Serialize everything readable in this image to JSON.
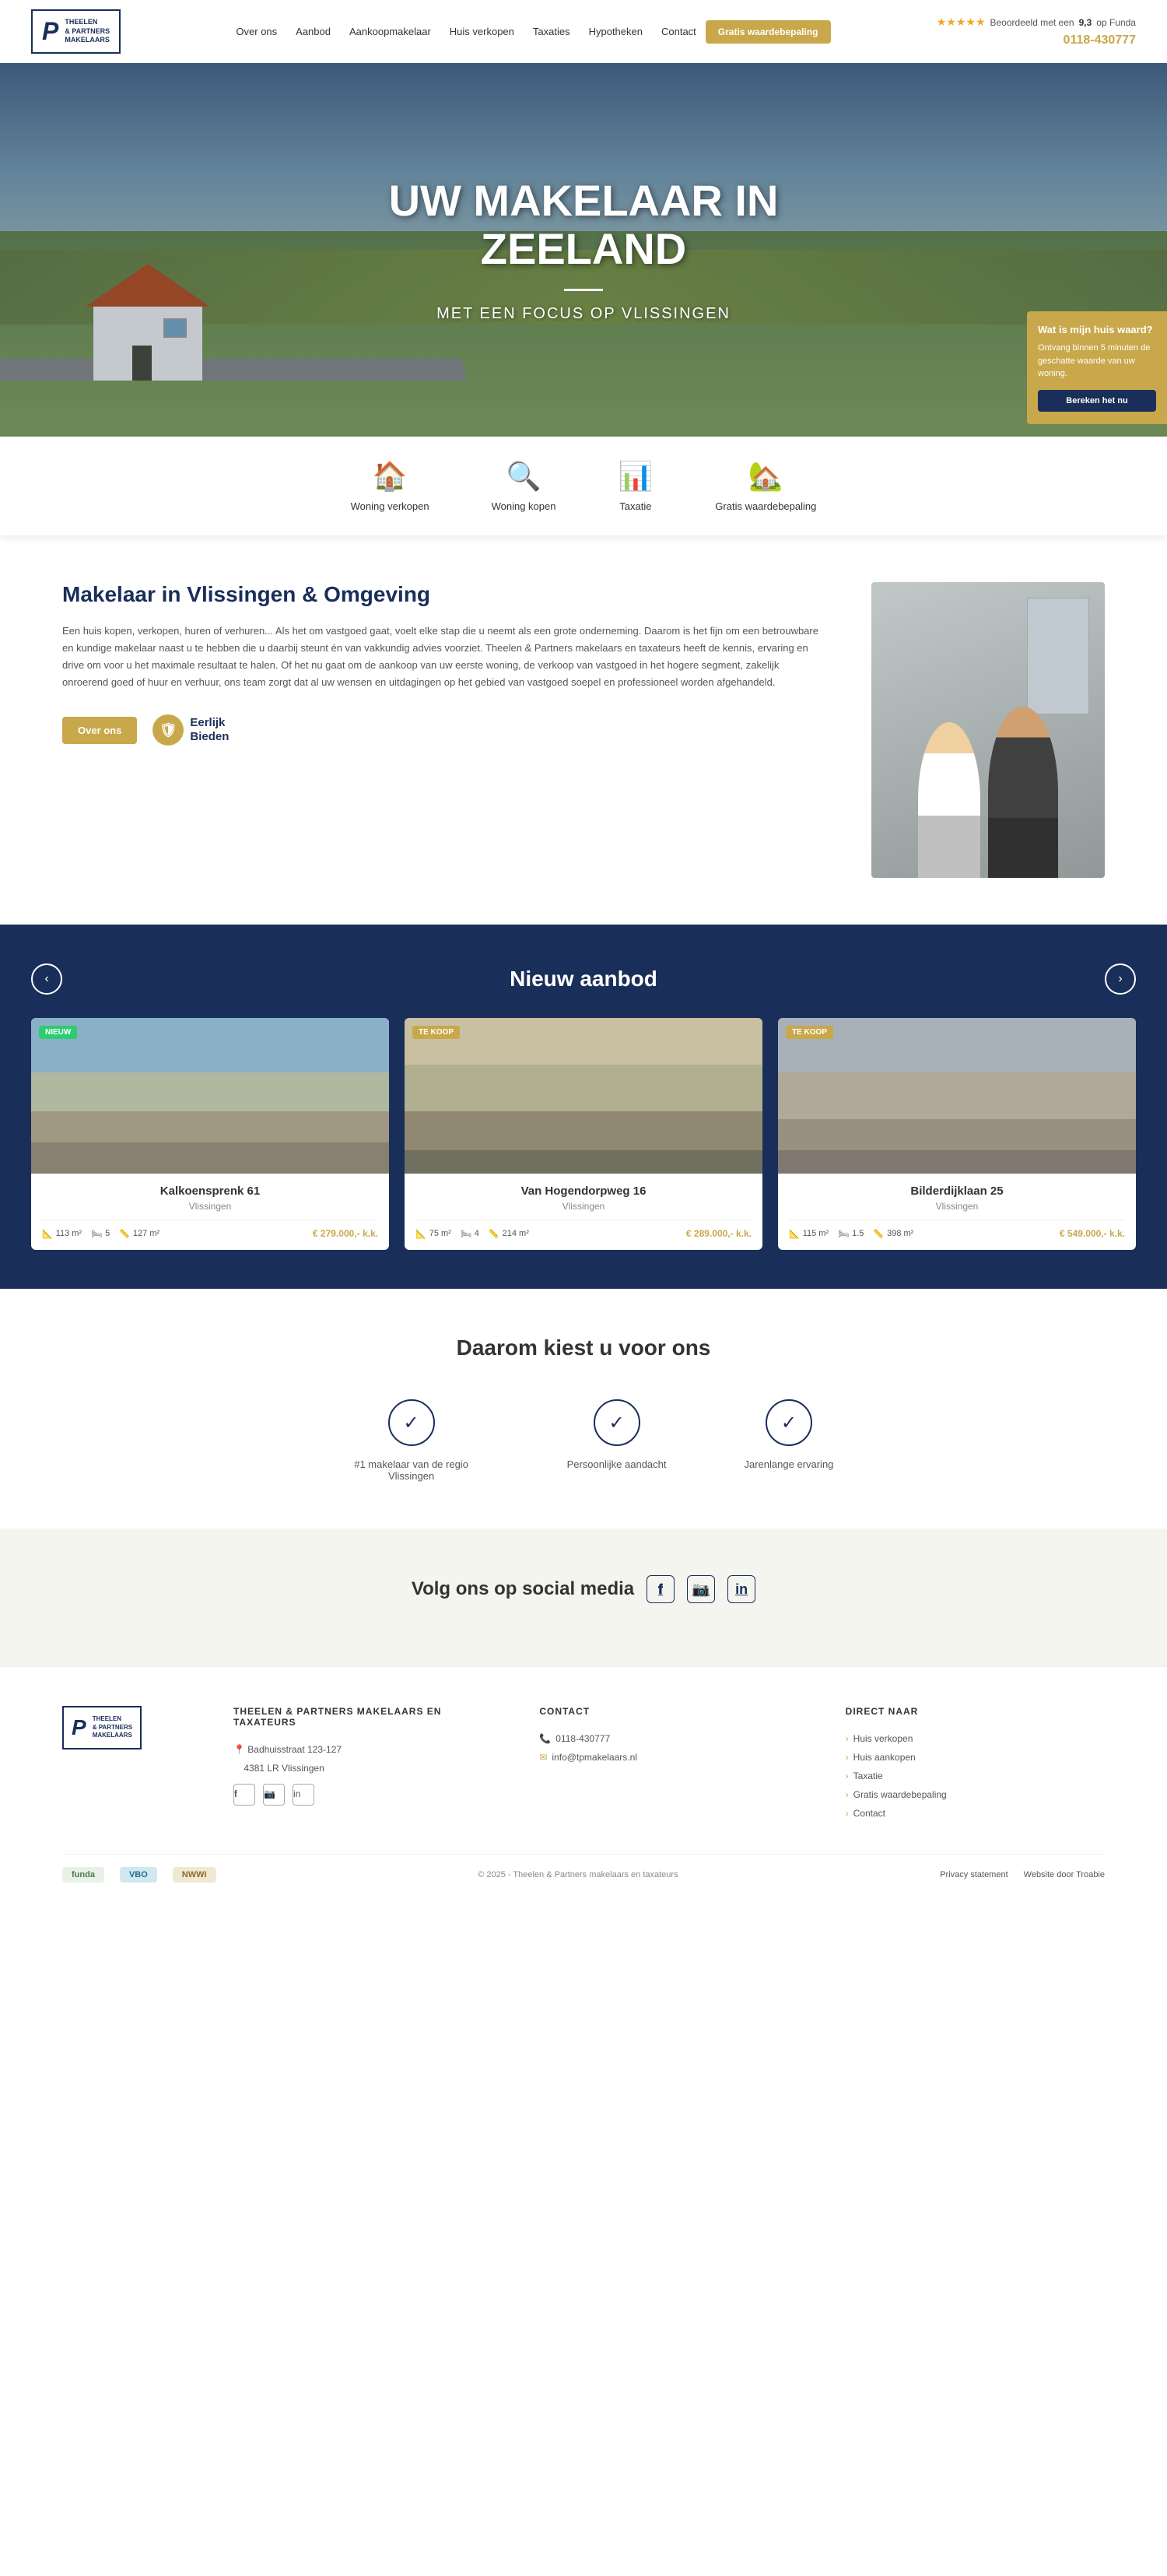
{
  "header": {
    "logo": {
      "letter": "P",
      "line1": "THEELEN",
      "line2": "& PARTNERS",
      "line3": "makelaars"
    },
    "rating": {
      "stars": "★★★★★",
      "text": "Beoordeeld met een",
      "score": "9,3",
      "platform": "op Funda"
    },
    "phone": "0118-430777",
    "nav": [
      "Over ons",
      "Aanbod",
      "Aankoopmakelaar",
      "Huis verkopen",
      "Taxaties",
      "Hypotheken",
      "Contact"
    ],
    "cta": "Gratis waardebepaling"
  },
  "hero": {
    "title_line1": "UW MAKELAAR IN",
    "title_line2": "ZEELAND",
    "subtitle": "MET EEN FOCUS OP VLISSINGEN"
  },
  "quicklinks": [
    {
      "icon": "🏠",
      "label": "Woning verkopen"
    },
    {
      "icon": "🔍",
      "label": "Woning kopen"
    },
    {
      "icon": "📊",
      "label": "Taxatie"
    },
    {
      "icon": "🏡",
      "label": "Gratis waardebepaling"
    }
  ],
  "about": {
    "title": "Makelaar in Vlissingen & Omgeving",
    "body": "Een huis kopen, verkopen, huren of verhuren... Als het om vastgoed gaat, voelt elke stap die u neemt als een grote onderneming. Daarom is het fijn om een betrouwbare en kundige makelaar naast u te hebben die u daarbij steunt én van vakkundig advies voorziet. Theelen & Partners makelaars en taxateurs heeft de kennis, ervaring en drive om voor u het maximale resultaat te halen. Of het nu gaat om de aankoop van uw eerste woning, de verkoop van vastgoed in het hogere segment, zakelijk onroerend goed of huur en verhuur, ons team zorgt dat al uw wensen en uitdagingen op het gebied van vastgoed soepel en professioneel worden afgehandeld.",
    "btn_label": "Over ons",
    "eerlijk_label": "Eerlijk\nBieden"
  },
  "floating_widget": {
    "title": "Wat is mijn huis waard?",
    "body": "Ontvang binnen 5 minuten de geschatte waarde van uw woning.",
    "btn": "Bereken het nu"
  },
  "aanbod": {
    "title": "Nieuw aanbod",
    "properties": [
      {
        "badge": "NIEUW",
        "badge_type": "nieuw",
        "title": "Kalkoensprenk 61",
        "city": "Vlissingen",
        "size": "113 m²",
        "rooms": "5",
        "lot": "127 m²",
        "price": "€ 279.000,- k.k."
      },
      {
        "badge": "TE KOOP",
        "badge_type": "te-koop",
        "title": "Van Hogendorpweg 16",
        "city": "Vlissingen",
        "size": "75 m²",
        "rooms": "4",
        "lot": "214 m²",
        "price": "€ 289.000,- k.k."
      },
      {
        "badge": "TE KOOP",
        "badge_type": "te-koop",
        "title": "Bilderdijklaan 25",
        "city": "Vlissingen",
        "size": "115 m²",
        "rooms": "1.5",
        "lot": "398 m²",
        "price": "€ 549.000,- k.k."
      }
    ]
  },
  "waarom": {
    "title": "Daarom kiest u voor ons",
    "items": [
      {
        "label": "#1 makelaar van de regio Vlissingen"
      },
      {
        "label": "Persoonlijke aandacht"
      },
      {
        "label": "Jarenlange ervaring"
      }
    ]
  },
  "social": {
    "title": "Volg ons op social media",
    "icons": [
      "f",
      "📷",
      "in"
    ]
  },
  "footer": {
    "company": {
      "name": "THEELEN & PARTNERS MAKELAARS EN TAXATEURS",
      "address_line1": "Badhuisstraat 123-127",
      "address_line2": "4381 LR Vlissingen"
    },
    "contact": {
      "title": "CONTACT",
      "phone": "0118-430777",
      "email": "info@tpmakelaars.nl"
    },
    "direct_naar": {
      "title": "DIRECT NAAR",
      "links": [
        "Huis verkopen",
        "Huis aankopen",
        "Taxatie",
        "Gratis waardebepaling",
        "Contact"
      ]
    },
    "bottom": {
      "copy": "© 2025 - Theelen & Partners makelaars en taxateurs",
      "privacy": "Privacy statement",
      "credit": "Website door Troabie"
    },
    "badges": [
      "funda",
      "VBO",
      "NWWI"
    ]
  }
}
